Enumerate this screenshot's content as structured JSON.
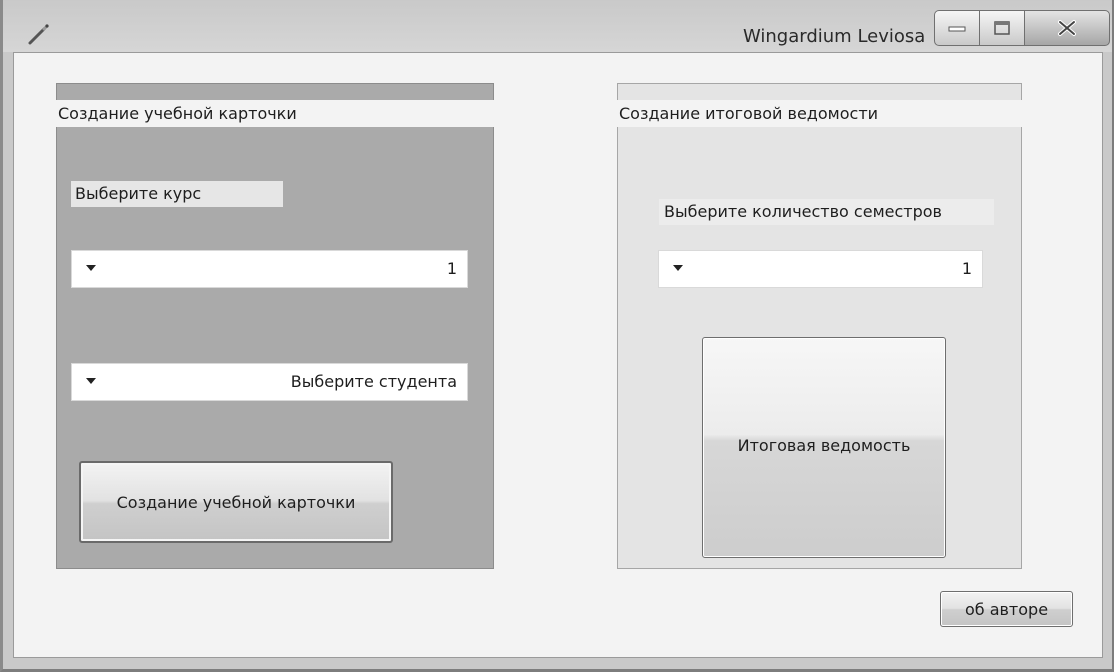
{
  "window": {
    "title": "Wingardium Leviosa",
    "icon": "wand-icon"
  },
  "titlebar_buttons": {
    "minimize": "minimize-icon",
    "maximize": "maximize-icon",
    "close": "close-icon"
  },
  "card_panel": {
    "header": "Создание учебной карточки",
    "course_label": "Выберите курс",
    "course_value": "1",
    "student_value": "Выберите студента",
    "create_button": "Создание учебной карточки"
  },
  "statement_panel": {
    "header": "Создание итоговой ведомости",
    "semesters_label": "Выберите количество семестров",
    "semesters_value": "1",
    "statement_button": "Итоговая ведомость"
  },
  "about_button": "об авторе"
}
